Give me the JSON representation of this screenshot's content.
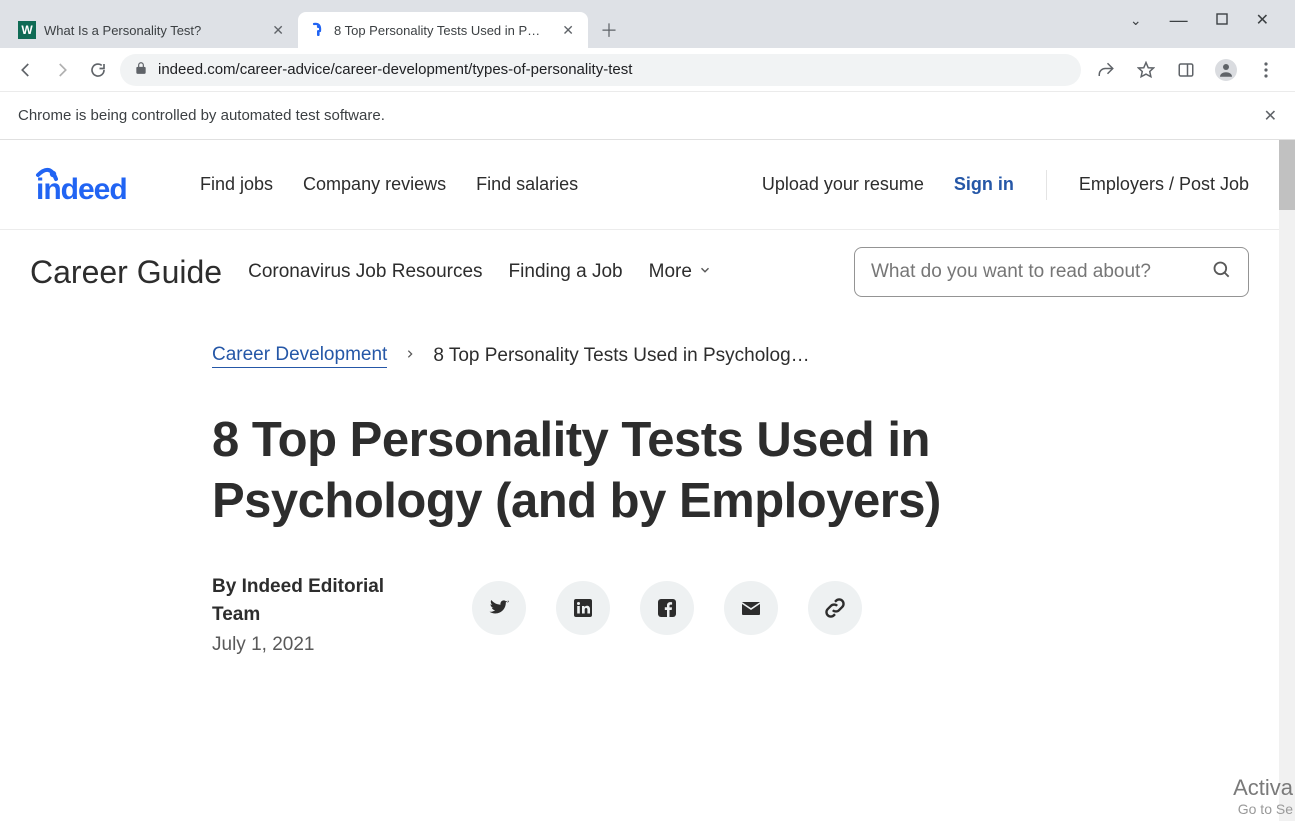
{
  "browser": {
    "tabs": [
      {
        "title": "What Is a Personality Test?",
        "active": false
      },
      {
        "title": "8 Top Personality Tests Used in P…",
        "active": true
      }
    ],
    "url": "indeed.com/career-advice/career-development/types-of-personality-test",
    "infobar": "Chrome is being controlled by automated test software."
  },
  "header": {
    "nav": {
      "find_jobs": "Find jobs",
      "company_reviews": "Company reviews",
      "find_salaries": "Find salaries"
    },
    "right": {
      "upload": "Upload your resume",
      "signin": "Sign in",
      "employers": "Employers / Post Job"
    }
  },
  "subheader": {
    "title": "Career Guide",
    "links": {
      "corona": "Coronavirus Job Resources",
      "finding": "Finding a Job",
      "more": "More"
    },
    "search_placeholder": "What do you want to read about?"
  },
  "breadcrumb": {
    "parent": "Career Development",
    "current": "8 Top Personality Tests Used in Psycholog…"
  },
  "article": {
    "title": "8 Top Personality Tests Used in Psychology (and by Employers)",
    "author": "By Indeed Editorial Team",
    "date": "July 1, 2021"
  },
  "watermark": {
    "l1": "Activa",
    "l2": "Go to Se"
  }
}
